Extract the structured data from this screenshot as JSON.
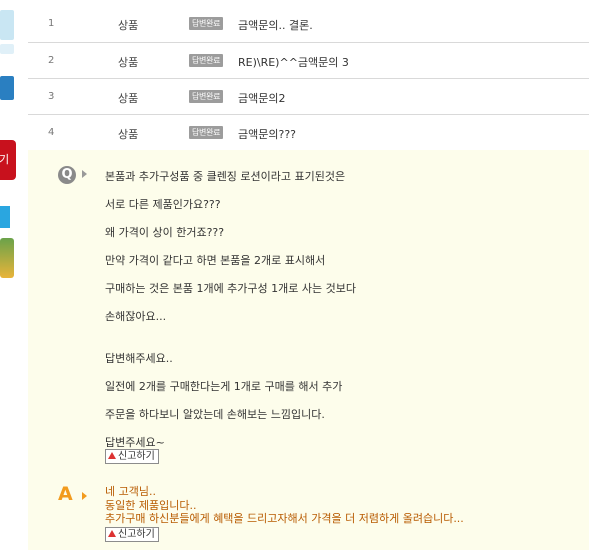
{
  "list": {
    "rows": [
      {
        "num": "1",
        "category": "상품",
        "badge": "답변완료",
        "title": "금액문의.. 결론."
      },
      {
        "num": "2",
        "category": "상품",
        "badge": "답변완료",
        "title": "RE)\\RE)^^금액문의 3"
      },
      {
        "num": "3",
        "category": "상품",
        "badge": "답변완료",
        "title": "금액문의2"
      },
      {
        "num": "4",
        "category": "상품",
        "badge": "답변완료",
        "title": "금액문의???"
      }
    ]
  },
  "question": {
    "icon": "Q",
    "lines": [
      "본품과 추가구성품 중 클렌징 로션이라고 표기된것은",
      "서로 다른 제품인가요???",
      "왜 가격이 상이 한거죠???",
      "만약 가격이 같다고 하면 본품을 2개로 표시해서",
      "구매하는 것은 본품 1개에 추가구성 1개로 사는 것보다",
      "손해잖아요...",
      "답변해주세요..",
      "일전에 2개를 구매한다는게 1개로 구매를 해서 추가",
      "주문을 하다보니 알았는데 손해보는 느낌입니다.",
      "답변주세요~"
    ],
    "report_label": "신고하기"
  },
  "answer": {
    "icon": "A",
    "lines": [
      "네 고객님..",
      "동일한 제품입니다..",
      "추가구매 하신분들에게 혜택을 드리고자해서 가격을 더 저렴하게 올려습니다..."
    ],
    "report_label": "신고하기"
  },
  "sidebar": {
    "button_label": "기"
  },
  "colors": {
    "qa_background": "#fdfdeb",
    "answer_text": "#b85a00",
    "answer_icon": "#f29b1e",
    "badge": "#9c9c9c"
  },
  "icons": {
    "question": "q-letter-icon",
    "answer": "a-letter-icon",
    "report": "warning-triangle-icon"
  }
}
